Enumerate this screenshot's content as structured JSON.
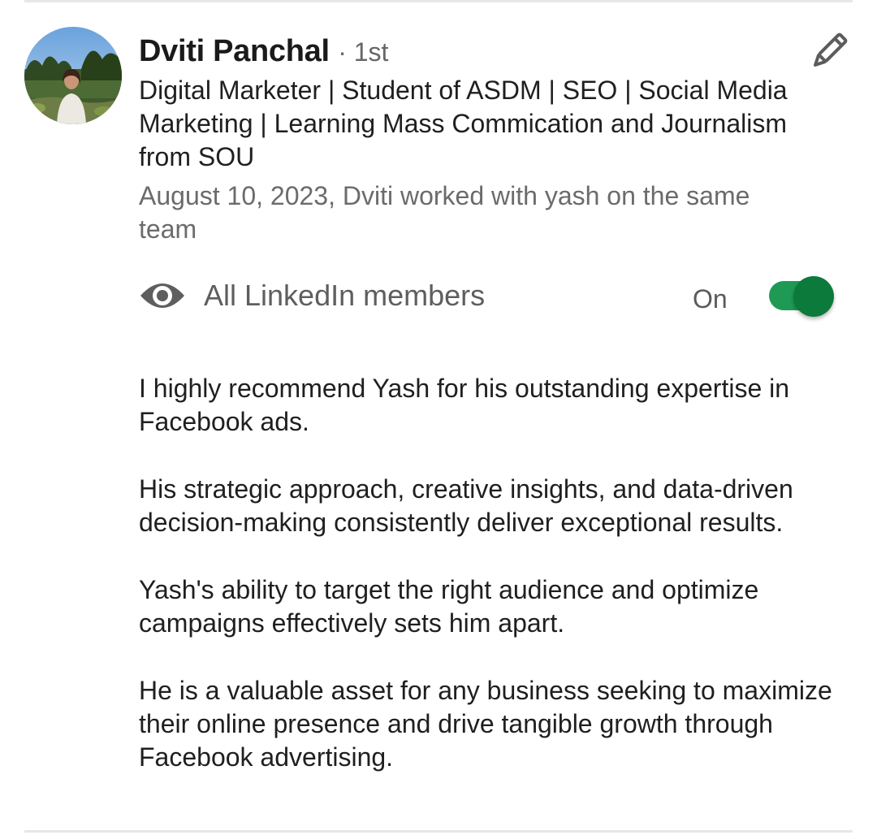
{
  "recommender": {
    "name": "Dviti Panchal",
    "degree": "· 1st",
    "headline": "Digital Marketer | Student of ASDM | SEO | Social Media Marketing | Learning Mass Commication and Journalism from SOU",
    "relationship": "August 10, 2023, Dviti worked with yash on the same team"
  },
  "icons": {
    "edit": "pencil-icon",
    "visibility": "eye-icon"
  },
  "visibility": {
    "label": "All LinkedIn members",
    "state_label": "On",
    "enabled": true
  },
  "colors": {
    "toggle_track": "#1f9a55",
    "toggle_thumb": "#0b7a3a",
    "secondary_text": "#6b6b6b"
  },
  "recommendation": {
    "paragraphs": [
      "I highly recommend Yash for his outstanding expertise in Facebook ads.",
      "His strategic approach, creative insights, and data-driven decision-making consistently deliver exceptional results.",
      "Yash's ability to target the right audience and optimize campaigns effectively sets him apart.",
      "He is a valuable asset for any business seeking to maximize their online presence and drive tangible growth through Facebook advertising."
    ]
  }
}
